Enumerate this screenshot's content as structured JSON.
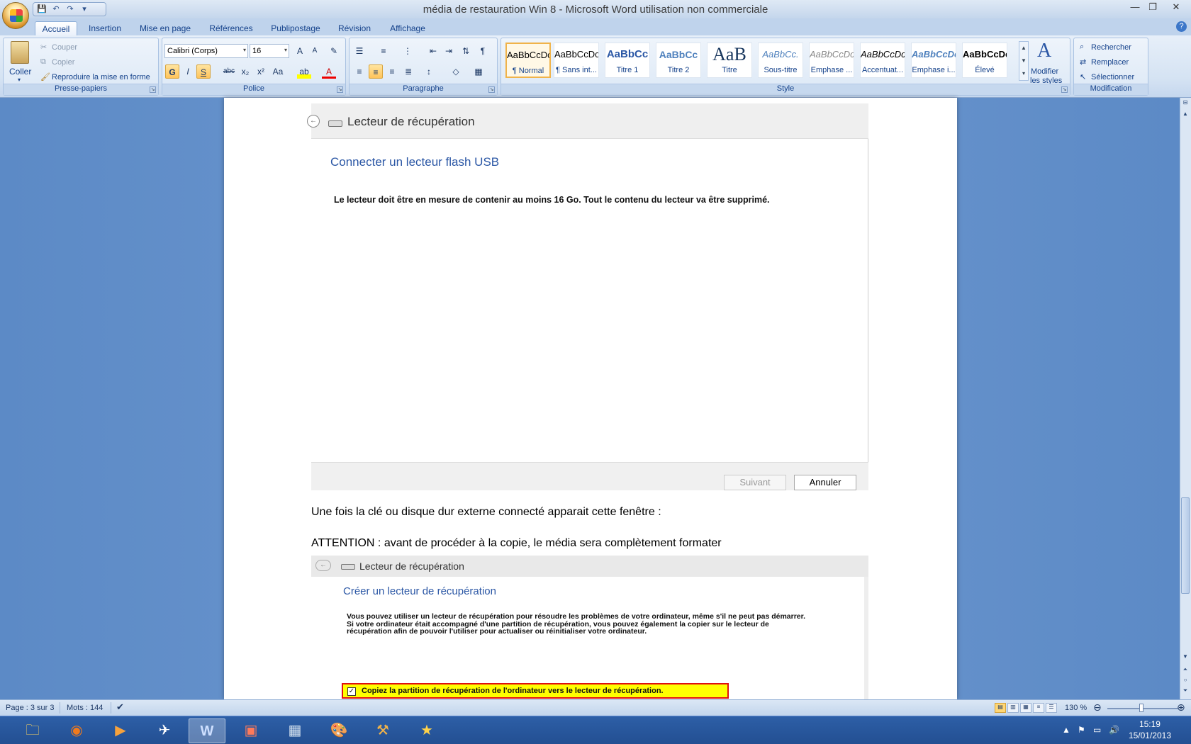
{
  "window": {
    "title": "média de restauration Win 8 - Microsoft Word utilisation non commerciale",
    "minimize": "—",
    "restore": "❐",
    "close": "✕"
  },
  "qat": {
    "save": "💾",
    "undo": "↶",
    "redo": "↷",
    "more": "▾"
  },
  "tabs": [
    "Accueil",
    "Insertion",
    "Mise en page",
    "Références",
    "Publipostage",
    "Révision",
    "Affichage"
  ],
  "help": "?",
  "clipboard": {
    "label": "Presse-papiers",
    "paste": "Coller",
    "cut": "Couper",
    "copy": "Copier",
    "format_painter": "Reproduire la mise en forme"
  },
  "font": {
    "label": "Police",
    "name": "Calibri (Corps)",
    "size": "16",
    "grow": "A",
    "shrink": "A",
    "clear": "✎",
    "bold": "G",
    "italic": "I",
    "underline": "S",
    "strike": "abc",
    "sub": "x₂",
    "sup": "x²",
    "case": "Aa",
    "highlight": "ab",
    "color": "A"
  },
  "paragraph": {
    "label": "Paragraphe"
  },
  "styles": {
    "label": "Style",
    "items": [
      {
        "preview": "AaBbCcDc",
        "name": "¶ Normal"
      },
      {
        "preview": "AaBbCcDc",
        "name": "¶ Sans int..."
      },
      {
        "preview": "AaBbCc",
        "name": "Titre 1"
      },
      {
        "preview": "AaBbCc",
        "name": "Titre 2"
      },
      {
        "preview": "AaB",
        "name": "Titre"
      },
      {
        "preview": "AaBbCc.",
        "name": "Sous-titre"
      },
      {
        "preview": "AaBbCcDc",
        "name": "Emphase ..."
      },
      {
        "preview": "AaBbCcDc",
        "name": "Accentuat..."
      },
      {
        "preview": "AaBbCcDc",
        "name": "Emphase i..."
      },
      {
        "preview": "AaBbCcDc",
        "name": "Élevé"
      }
    ],
    "modify_line1": "Modifier",
    "modify_line2": "les styles"
  },
  "editing": {
    "label": "Modification",
    "find": "Rechercher",
    "replace": "Remplacer",
    "select": "Sélectionner"
  },
  "doc": {
    "shot1": {
      "header": "Lecteur de récupération",
      "heading": "Connecter un lecteur flash USB",
      "body": "Le lecteur doit être en mesure de contenir au moins 16 Go. Tout le contenu du lecteur va être supprimé.",
      "next": "Suivant",
      "cancel": "Annuler"
    },
    "line1": "Une fois la clé ou disque dur externe connecté apparait cette fenêtre :",
    "line2": "ATTENTION : avant de procéder à la copie, le média sera complètement formater",
    "shot2": {
      "header": "Lecteur de récupération",
      "heading": "Créer un lecteur de récupération",
      "body": "Vous pouvez utiliser un lecteur de récupération pour résoudre les problèmes de votre ordinateur, même s'il ne peut pas démarrer. Si votre ordinateur était accompagné d'une partition de récupération, vous pouvez également la copier sur le lecteur de récupération afin de pouvoir l'utiliser pour actualiser ou réinitialiser votre ordinateur.",
      "checkbox": "Copiez la partition de récupération de l'ordinateur vers le lecteur de récupération."
    }
  },
  "status": {
    "page": "Page : 3 sur 3",
    "words": "Mots : 144",
    "zoom": "130 %"
  },
  "taskbar": {
    "time": "15:19",
    "date": "15/01/2013"
  },
  "colors": {
    "accent": "#15428b",
    "ribbon": "#dce8f6",
    "highlight": "#ffff00",
    "highlight_border": "#e01010"
  }
}
